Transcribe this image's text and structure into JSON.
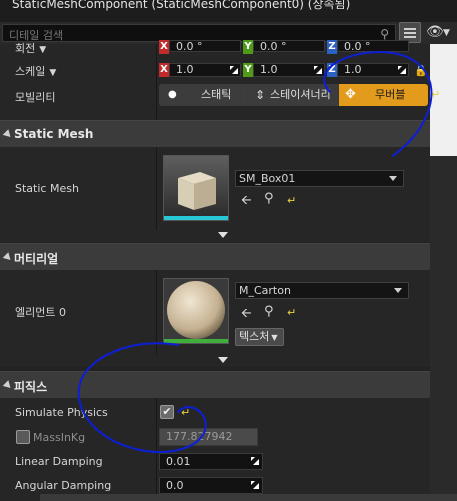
{
  "window": {
    "title": "StaticMeshComponent (StaticMeshComponent0) (상속됨)"
  },
  "search": {
    "placeholder": "디테일 검색"
  },
  "rotation": {
    "label": "회전",
    "x": "0.0 °",
    "y": "0.0 °",
    "z": "0.0 °"
  },
  "scale": {
    "label": "스케일",
    "x": "1.0",
    "y": "1.0",
    "z": "1.0"
  },
  "mobility": {
    "label": "모빌리티",
    "options": [
      "스태틱",
      "스테이셔너리",
      "무버블"
    ],
    "selected": "무버블"
  },
  "static_mesh_section": {
    "title": "Static Mesh",
    "row_label": "Static Mesh",
    "asset_name": "SM_Box01"
  },
  "materials_section": {
    "title": "머티리얼",
    "row_label": "엘리먼트 0",
    "asset_name": "M_Carton",
    "textures_button": "텍스처"
  },
  "physics_section": {
    "title": "피직스",
    "simulate_physics_label": "Simulate Physics",
    "simulate_physics_checked": true,
    "mass_label": "MassInKg",
    "mass_value": "177.827942",
    "linear_damping_label": "Linear Damping",
    "linear_damping_value": "0.01",
    "angular_damping_label": "Angular Damping",
    "angular_damping_value": "0.0"
  },
  "colors": {
    "background": "#222222",
    "movable_accent": "#e39b1c",
    "axis_x": "#c32a2a",
    "axis_y": "#4f9a19",
    "axis_z": "#2c61c4",
    "annotation_ink": "#0d1fd6",
    "reset_icon": "#e8d43a"
  },
  "icons": {
    "search": "magnifier-icon",
    "view_options": "eye-icon",
    "browse": "magnifier-icon",
    "use_selected": "arrow-left-icon",
    "reset": "reset-arrow-icon"
  }
}
